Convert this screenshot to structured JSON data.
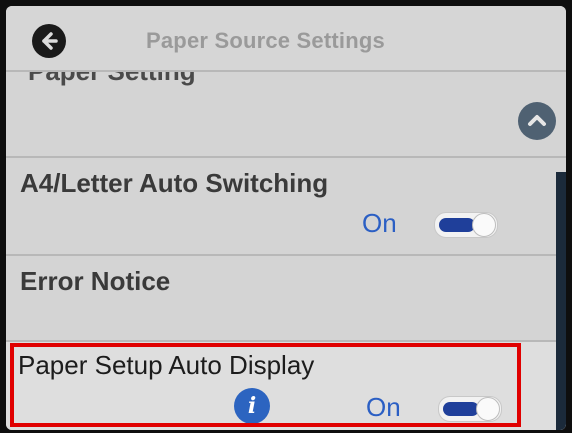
{
  "header": {
    "title": "Paper Source Settings",
    "back_icon": "back-arrow-icon"
  },
  "list": {
    "partial_item_label": "Paper Setting",
    "scroll_icon": "chevron-up-icon",
    "items": [
      {
        "label": "A4/Letter Auto Switching",
        "value": "On",
        "toggle_on": true
      },
      {
        "label": "Error Notice"
      },
      {
        "label": "Paper Setup Auto Display",
        "value": "On",
        "toggle_on": true,
        "info_icon": "info-icon"
      }
    ]
  },
  "colors": {
    "accent": "#2b5fc4",
    "toggle_fill": "#1f3f9a",
    "highlight": "#e00000"
  }
}
